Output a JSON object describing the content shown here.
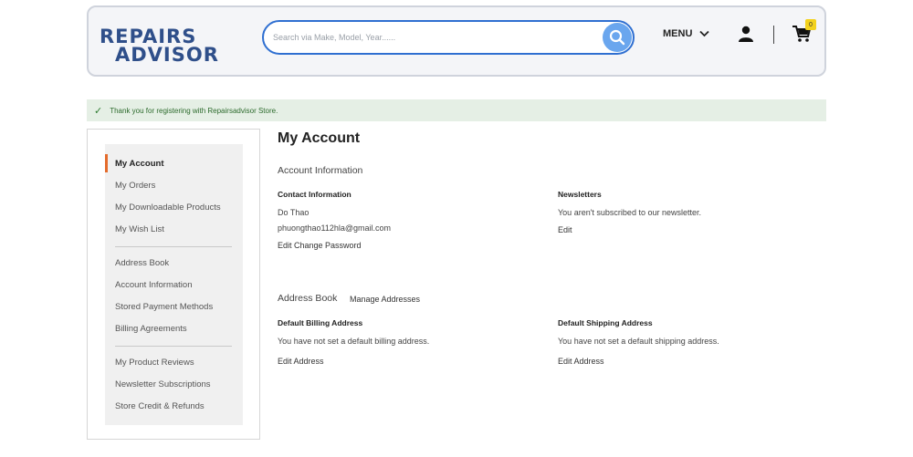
{
  "header": {
    "logo_line1": "REPAIRS",
    "logo_line2": "ADVISOR",
    "search_placeholder": "Search via Make, Model, Year......",
    "menu_label": "MENU",
    "cart_count": "0"
  },
  "message": {
    "text": "Thank you for registering with Repairsadvisor Store."
  },
  "sidebar": {
    "items": [
      {
        "label": "My Account"
      },
      {
        "label": "My Orders"
      },
      {
        "label": "My Downloadable Products"
      },
      {
        "label": "My Wish List"
      },
      {
        "label": "Address Book"
      },
      {
        "label": "Account Information"
      },
      {
        "label": "Stored Payment Methods"
      },
      {
        "label": "Billing Agreements"
      },
      {
        "label": "My Product Reviews"
      },
      {
        "label": "Newsletter Subscriptions"
      },
      {
        "label": "Store Credit & Refunds"
      }
    ]
  },
  "main": {
    "title": "My Account",
    "account_info": {
      "title": "Account Information",
      "contact": {
        "title": "Contact Information",
        "name": "Do Thao",
        "email": "phuongthao112hla@gmail.com",
        "edit": "Edit",
        "change_password": "Change Password"
      },
      "newsletters": {
        "title": "Newsletters",
        "text": "You aren't subscribed to our newsletter.",
        "edit": "Edit"
      }
    },
    "address_book": {
      "title": "Address Book",
      "manage": "Manage Addresses",
      "billing": {
        "title": "Default Billing Address",
        "text": "You have not set a default billing address.",
        "edit": "Edit Address"
      },
      "shipping": {
        "title": "Default Shipping Address",
        "text": "You have not set a default shipping address.",
        "edit": "Edit Address"
      }
    }
  },
  "colors": {
    "brand": "#2f4f8a",
    "accent": "#2f6fd1",
    "active_marker": "#e46b2c",
    "success_bg": "#e5efe5"
  }
}
